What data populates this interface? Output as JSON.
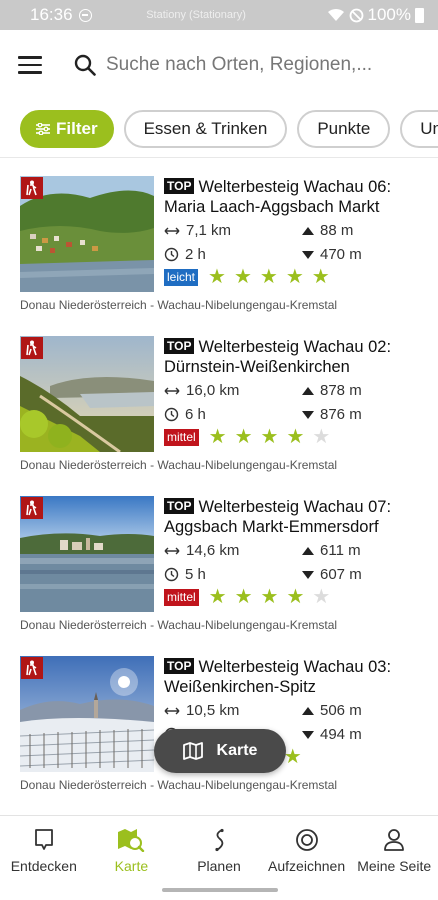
{
  "status": {
    "time": "16:36",
    "notification": "Stationy (Stationary)",
    "battery": "100%"
  },
  "search": {
    "placeholder": "Suche nach Orten, Regionen,..."
  },
  "chips": [
    {
      "label": "Filter"
    },
    {
      "label": "Essen & Trinken"
    },
    {
      "label": "Punkte"
    },
    {
      "label": "Un"
    }
  ],
  "tours": [
    {
      "badge": "TOP",
      "title": "Welterbesteig Wachau 06: Maria Laach-Aggsbach Markt",
      "distance": "7,1 km",
      "ascent": "88 m",
      "duration": "2 h",
      "descent": "470 m",
      "difficulty": "leicht",
      "rating": 5,
      "region": "Donau Niederösterreich - Wachau-Nibelungengau-Kremstal"
    },
    {
      "badge": "TOP",
      "title": "Welterbesteig Wachau 02: Dürnstein-Weißenkirchen",
      "distance": "16,0 km",
      "ascent": "878 m",
      "duration": "6 h",
      "descent": "876 m",
      "difficulty": "mittel",
      "rating": 4,
      "region": "Donau Niederösterreich - Wachau-Nibelungengau-Kremstal"
    },
    {
      "badge": "TOP",
      "title": "Welterbesteig Wachau 07: Aggsbach Markt-Emmersdorf",
      "distance": "14,6 km",
      "ascent": "611 m",
      "duration": "5 h",
      "descent": "607 m",
      "difficulty": "mittel",
      "rating": 4,
      "region": "Donau Niederösterreich - Wachau-Nibelungengau-Kremstal"
    },
    {
      "badge": "TOP",
      "title": "Welterbesteig Wachau 03: Weißenkirchen-Spitz",
      "distance": "10,5 km",
      "ascent": "506 m",
      "duration": "",
      "descent": "494 m",
      "difficulty": "",
      "rating": 5,
      "region": "Donau Niederösterreich - Wachau-Nibelungengau-Kremstal"
    }
  ],
  "map_button": {
    "label": "Karte"
  },
  "nav": [
    {
      "label": "Entdecken",
      "icon": "explore-icon"
    },
    {
      "label": "Karte",
      "icon": "map-icon"
    },
    {
      "label": "Planen",
      "icon": "route-icon"
    },
    {
      "label": "Aufzeichnen",
      "icon": "record-icon"
    },
    {
      "label": "Meine Seite",
      "icon": "profile-icon"
    }
  ],
  "colors": {
    "accent": "#9bbf1e",
    "leicht": "#1f6dc2",
    "mittel": "#c0141c"
  }
}
